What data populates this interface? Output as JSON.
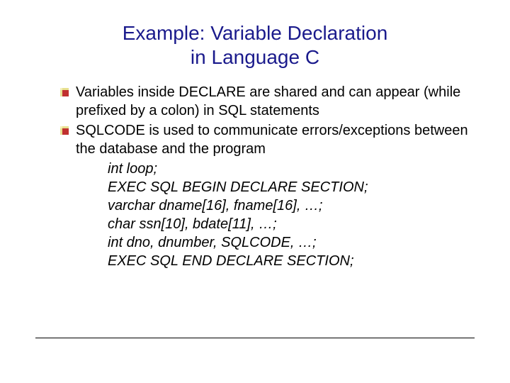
{
  "title_line1": "Example: Variable Declaration",
  "title_line2": "in Language C",
  "bullets": [
    "Variables inside DECLARE are shared and can appear (while prefixed by a colon) in SQL statements",
    "SQLCODE is used to communicate errors/exceptions between the database and the program"
  ],
  "code_lines": [
    "int loop;",
    "EXEC SQL BEGIN DECLARE SECTION;",
    "varchar dname[16], fname[16], …;",
    "char ssn[10], bdate[11], …;",
    "int dno, dnumber, SQLCODE, …;",
    "EXEC SQL END DECLARE SECTION;"
  ]
}
